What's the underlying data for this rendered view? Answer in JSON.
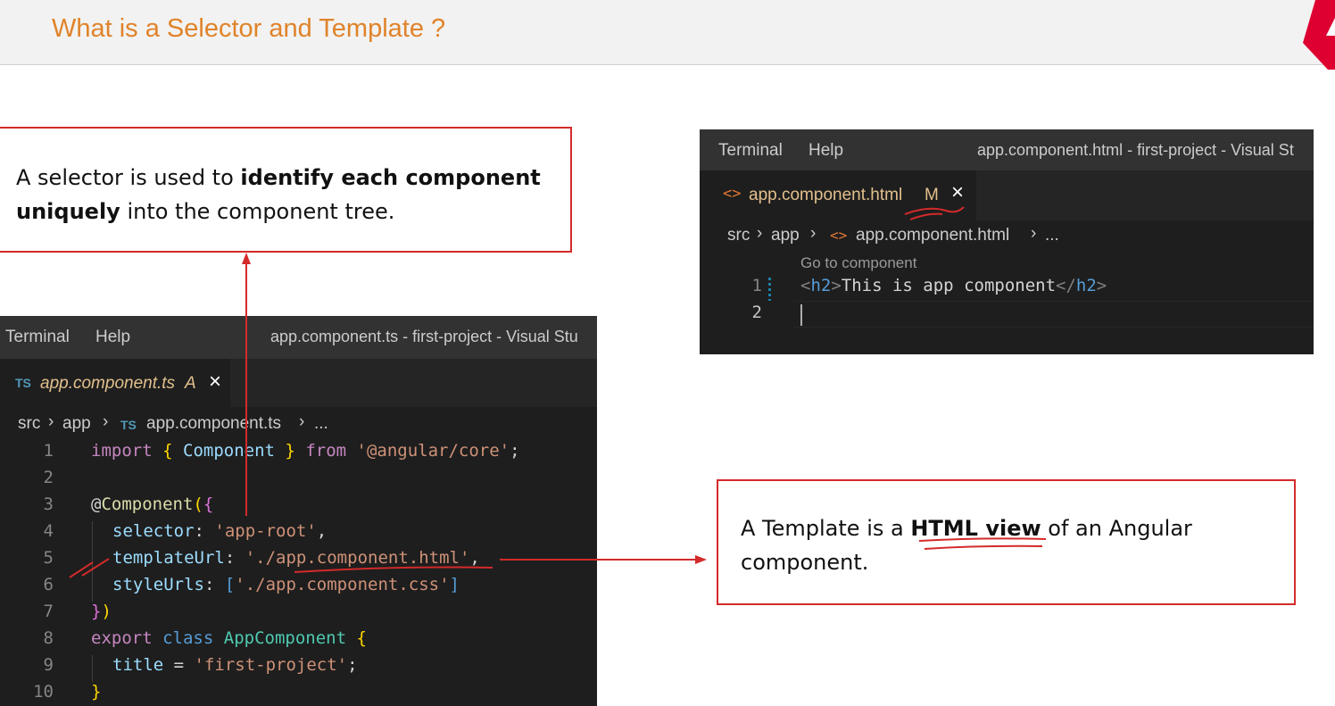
{
  "slide": {
    "title": "What is a Selector and Template ?"
  },
  "selector_callout": {
    "text_pre": "A selector is used to ",
    "text_bold_1": "identify each component",
    "text_bold_2": "uniquely",
    "text_post": " into the component tree."
  },
  "template_callout": {
    "text_pre": "A Template is a ",
    "text_bold": "HTML view",
    "text_post_1": " of an Angular",
    "text_post_2": "component."
  },
  "ts_editor": {
    "menu": [
      "Terminal",
      "Help"
    ],
    "window_title": "app.component.ts - first-project - Visual Stu",
    "tab": {
      "lang_badge": "TS",
      "filename": "app.component.ts",
      "status": "A",
      "close": "×"
    },
    "breadcrumb": {
      "src": "src",
      "app": "app",
      "lang_badge": "TS",
      "file": "app.component.ts",
      "more": "..."
    },
    "line_numbers": [
      "1",
      "2",
      "3",
      "4",
      "5",
      "6",
      "7",
      "8",
      "9",
      "10"
    ],
    "lines": {
      "l1": {
        "kw": "import",
        "b1": "{",
        "cls": "Component",
        "b2": "}",
        "from": "from",
        "str": "'@angular/core'",
        "end": ";"
      },
      "l3": {
        "at": "@",
        "dec": "Component",
        "p1": "(",
        "b1": "{"
      },
      "l4": {
        "prop": "selector",
        "colon": ": ",
        "str": "'app-root'",
        "end": ","
      },
      "l5": {
        "prop": "templateUrl",
        "colon": ": ",
        "str": "'./app.component.html'",
        "end": ","
      },
      "l6": {
        "prop": "styleUrls",
        "colon": ": ",
        "b1": "[",
        "str": "'./app.component.css'",
        "b2": "]"
      },
      "l7": {
        "b1": "}",
        "p1": ")"
      },
      "l8": {
        "kw1": "export",
        "kw2": "class",
        "cls": "AppComponent",
        "b1": "{"
      },
      "l9": {
        "prop": "title",
        "eq": " = ",
        "str": "'first-project'",
        "end": ";"
      },
      "l10": {
        "b1": "}"
      }
    }
  },
  "html_editor": {
    "menu": [
      "Terminal",
      "Help"
    ],
    "window_title": "app.component.html - first-project - Visual St",
    "tab": {
      "icon": "<>",
      "filename": "app.component.html",
      "status": "M",
      "close": "×"
    },
    "breadcrumb": {
      "src": "src",
      "app": "app",
      "icon": "<>",
      "file": "app.component.html",
      "more": "..."
    },
    "codelens": "Go to component",
    "line_numbers": [
      "1",
      "2"
    ],
    "line1": {
      "open_lt": "<",
      "open_tag": "h2",
      "open_gt": ">",
      "text": "This is app component",
      "close_lt": "</",
      "close_tag": "h2",
      "close_gt": ">"
    }
  },
  "colors": {
    "title_orange": "#e0832a",
    "callout_red": "#d42a2a",
    "editor_bg": "#1e1e1e",
    "annotation_red": "#d42a2a",
    "angular_red": "#dd0031"
  }
}
